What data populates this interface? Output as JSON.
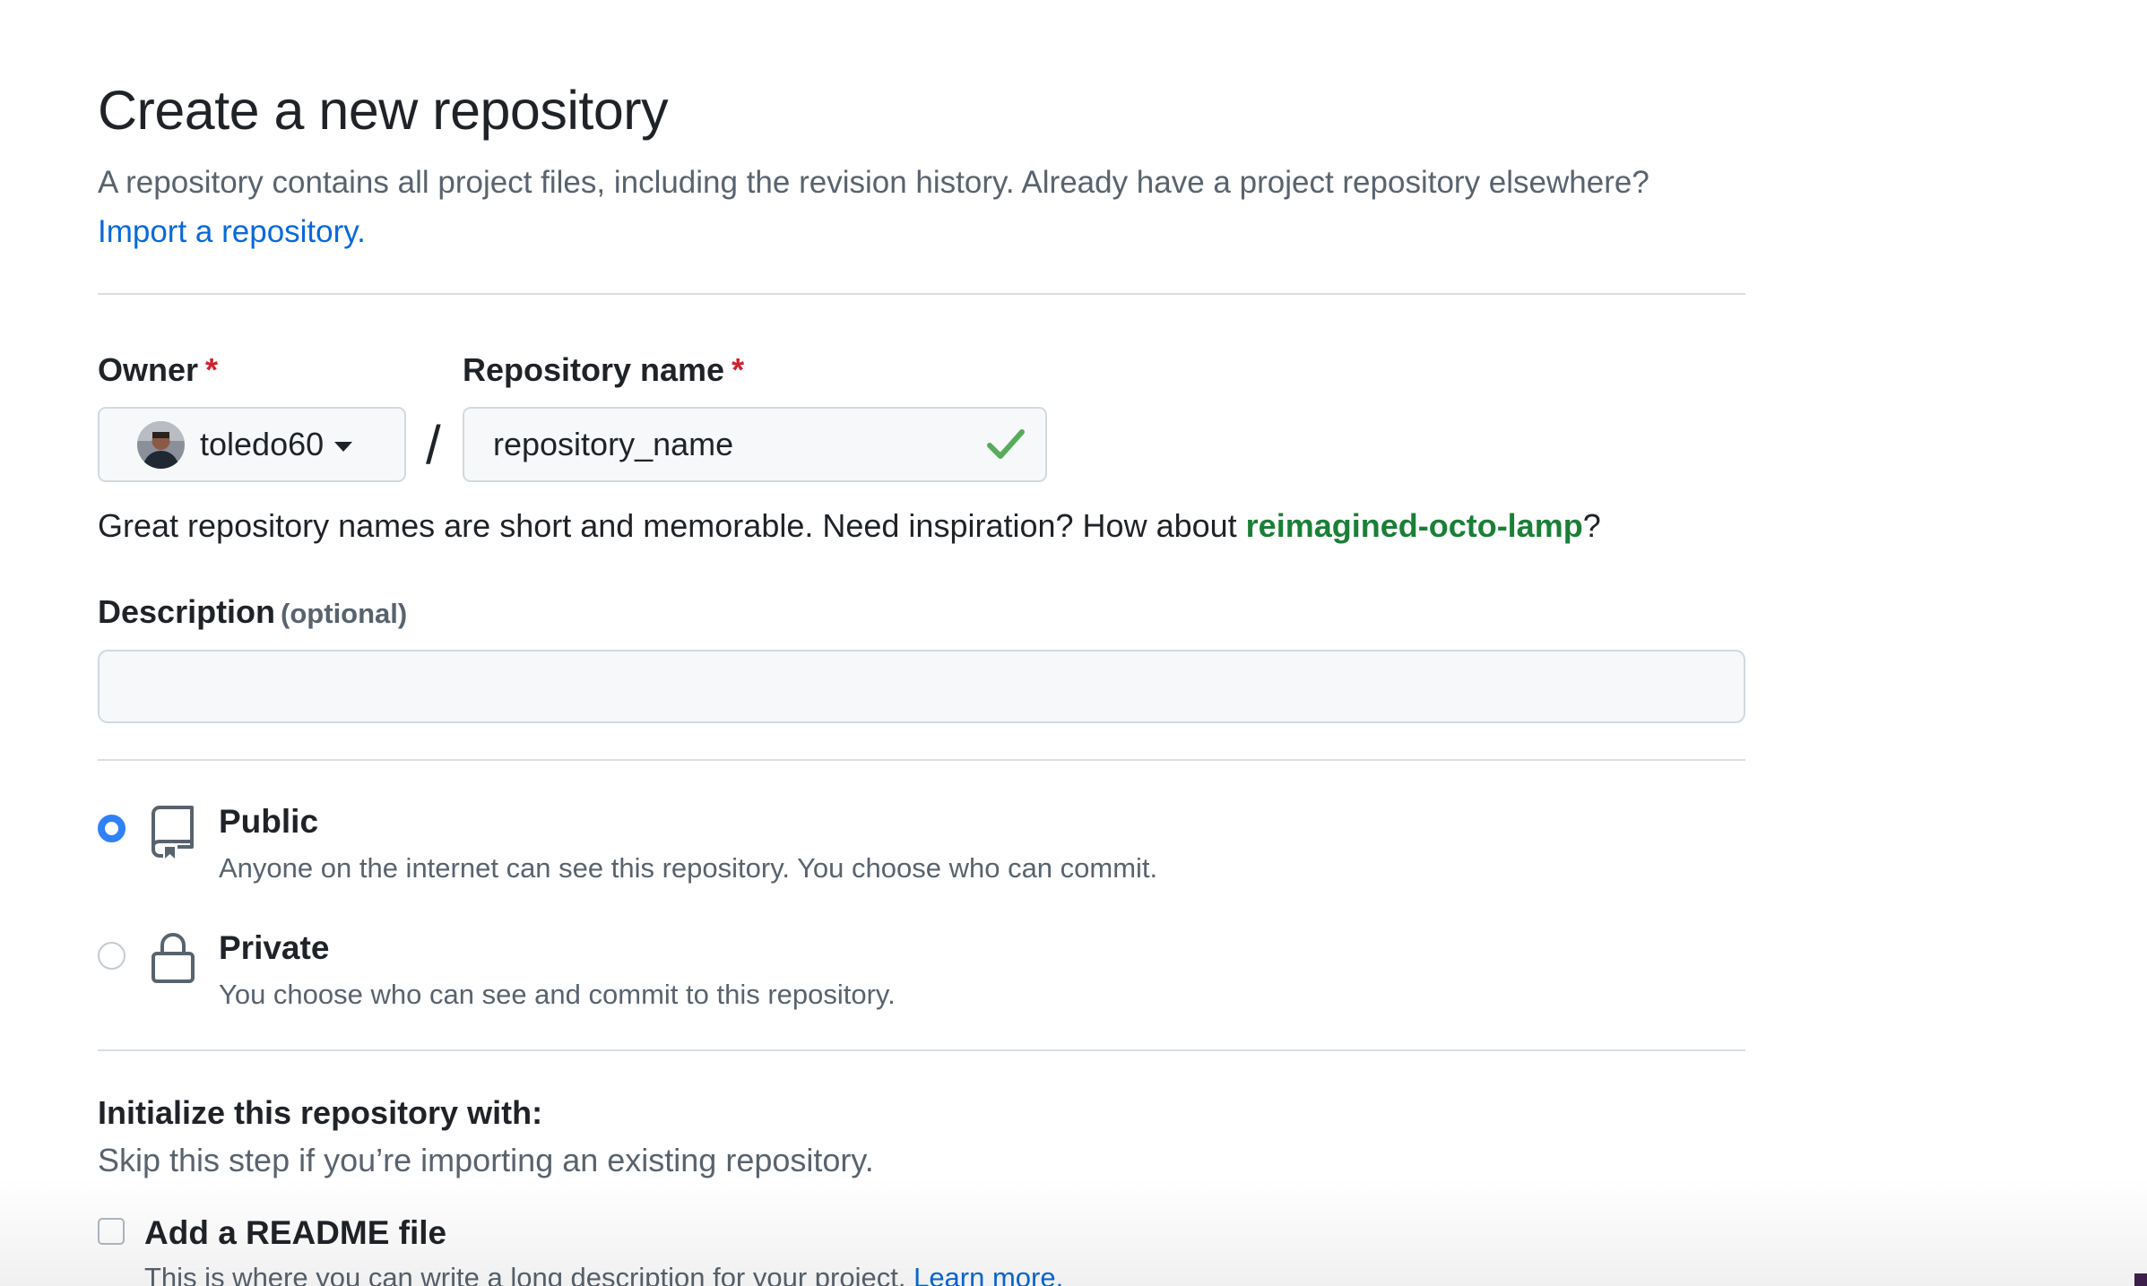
{
  "header": {
    "title": "Create a new repository",
    "subtitle_text": "A repository contains all project files, including the revision history. Already have a project repository elsewhere?",
    "import_link": "Import a repository."
  },
  "owner": {
    "label": "Owner",
    "required_marker": "*",
    "selected": "toledo60",
    "avatar_icon": "user-avatar"
  },
  "separator": "/",
  "repository_name": {
    "label": "Repository name",
    "required_marker": "*",
    "value": "repository_name",
    "status_icon": "check-icon",
    "status_color": "#57ab5a"
  },
  "hint": {
    "text_before": "Great repository names are short and memorable. Need inspiration? How about ",
    "suggestion": "reimagined-octo-lamp",
    "text_after": "?"
  },
  "description": {
    "label": "Description",
    "optional": "(optional)",
    "value": ""
  },
  "visibility": {
    "selected": "public",
    "options": [
      {
        "title": "Public",
        "desc": "Anyone on the internet can see this repository. You choose who can commit.",
        "icon": "repo-icon",
        "checked": true
      },
      {
        "title": "Private",
        "desc": "You choose who can see and commit to this repository.",
        "icon": "lock-icon",
        "checked": false
      }
    ]
  },
  "initialize": {
    "title": "Initialize this repository with:",
    "subtitle": "Skip this step if you’re importing an existing repository.",
    "readme": {
      "label": "Add a README file",
      "desc": "This is where you can write a long description for your project.",
      "link": "Learn more.",
      "checked": false
    }
  },
  "colors": {
    "link": "#0969da",
    "required": "#cf222e",
    "suggestion": "#1a7f37",
    "radio_selected": "#2f81f7"
  }
}
